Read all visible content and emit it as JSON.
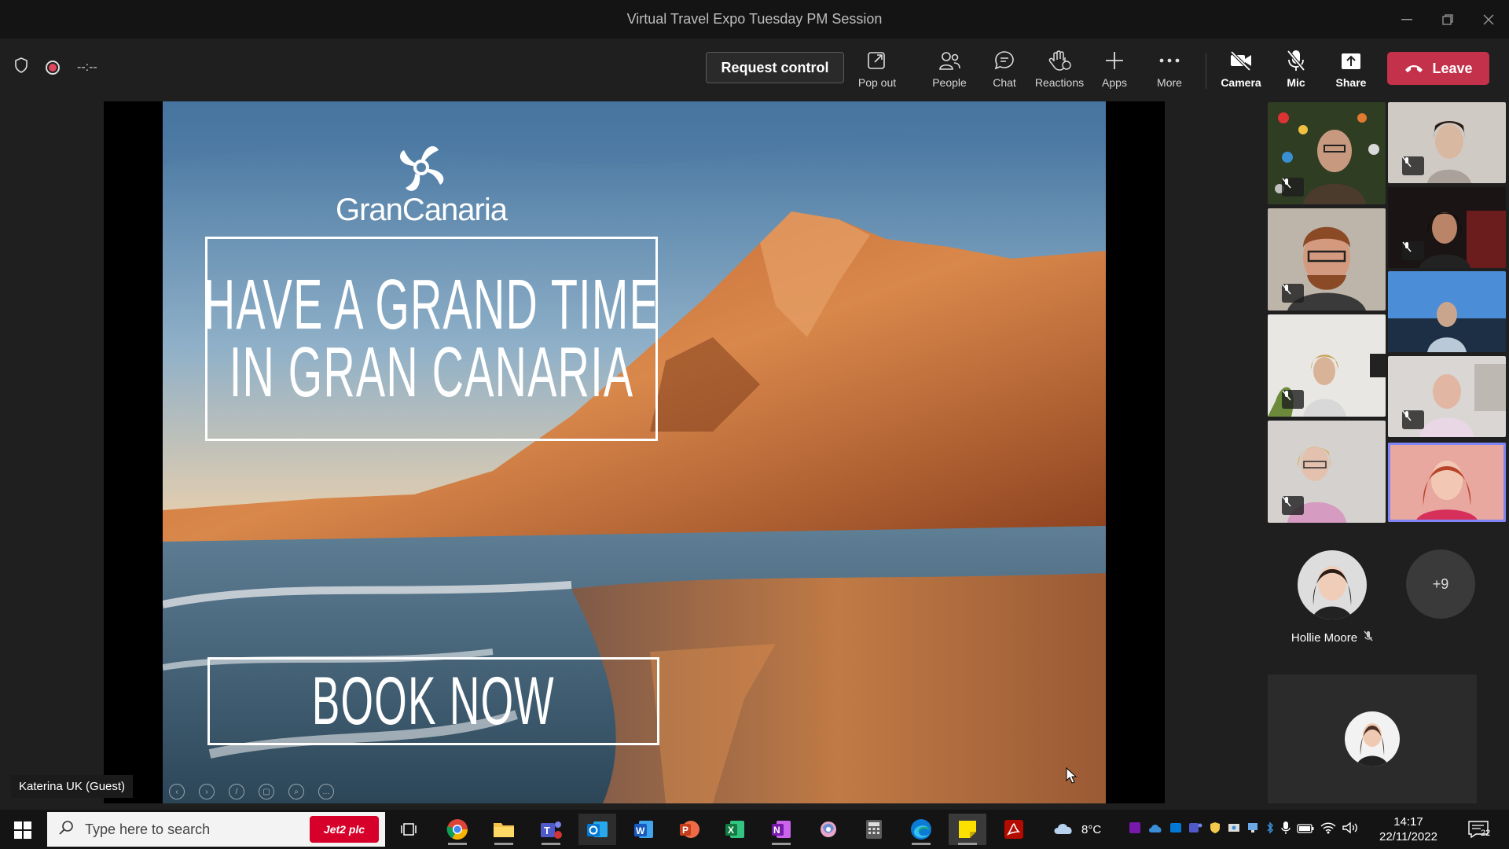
{
  "window": {
    "title": "Virtual Travel Expo Tuesday PM Session",
    "controls": [
      "minimize",
      "restore",
      "close"
    ]
  },
  "toolbar": {
    "timer": "--:--",
    "request_control": "Request control",
    "items": [
      {
        "id": "pop-out",
        "label": "Pop out",
        "icon": "pop-out-icon"
      },
      {
        "id": "people",
        "label": "People",
        "icon": "people-icon"
      },
      {
        "id": "chat",
        "label": "Chat",
        "icon": "chat-icon"
      },
      {
        "id": "reactions",
        "label": "Reactions",
        "icon": "reactions-icon"
      },
      {
        "id": "apps",
        "label": "Apps",
        "icon": "plus-icon"
      },
      {
        "id": "more",
        "label": "More",
        "icon": "more-icon"
      },
      {
        "id": "camera",
        "label": "Camera",
        "icon": "camera-off-icon"
      },
      {
        "id": "mic",
        "label": "Mic",
        "icon": "mic-off-icon"
      },
      {
        "id": "share",
        "label": "Share",
        "icon": "share-icon"
      }
    ],
    "leave": "Leave",
    "leave_color": "#c4314b"
  },
  "slide": {
    "logo": "GranCanaria",
    "headline_line1": "HAVE A GRAND TIME",
    "headline_line2": "IN GRAN CANARIA",
    "cta": "BOOK NOW"
  },
  "presenter_tag": "Katerina UK (Guest)",
  "participants": {
    "named": {
      "name": "Hollie Moore",
      "muted": true
    },
    "overflow": "+9",
    "active_color": "#7f85f5"
  },
  "taskbar": {
    "search_placeholder": "Type here to search",
    "search_badge": "Jet2 plc",
    "weather": "8°C",
    "time": "14:17",
    "date": "22/11/2022",
    "notifications": "22"
  }
}
